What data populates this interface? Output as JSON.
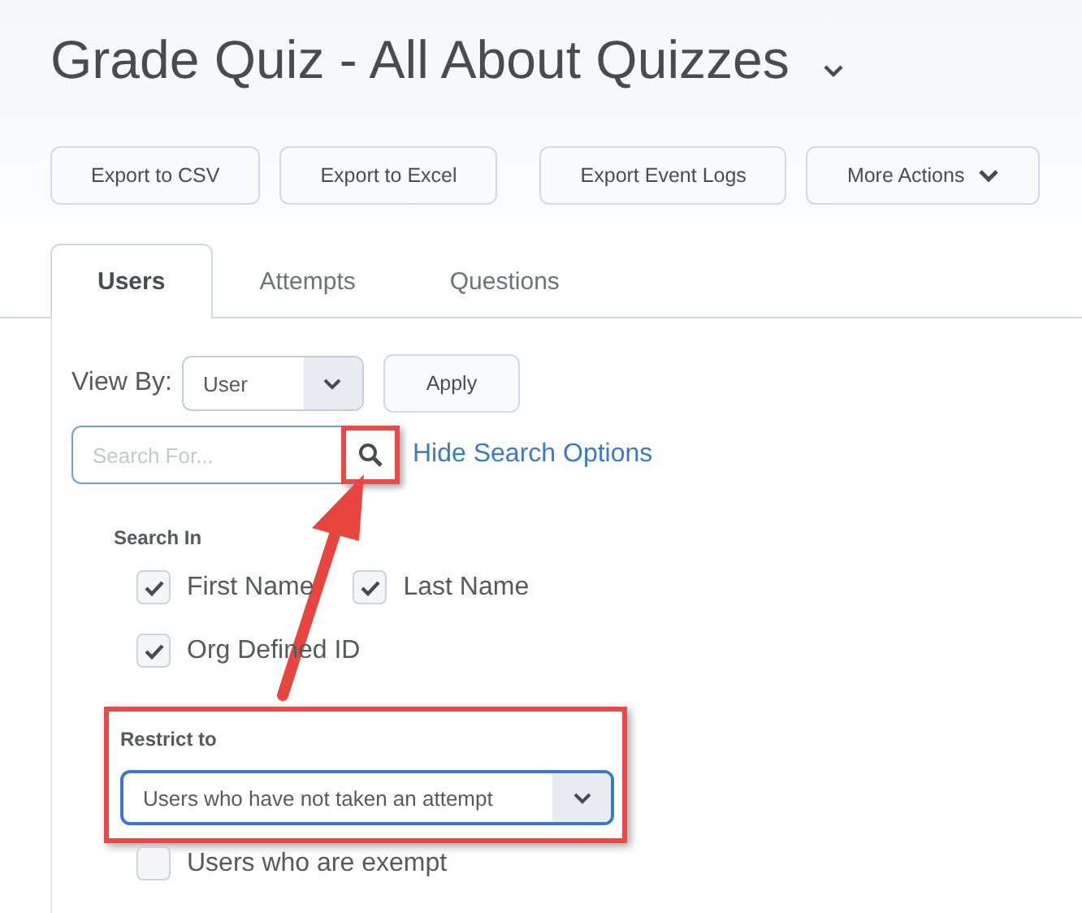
{
  "title": "Grade Quiz - All About Quizzes",
  "actions": [
    {
      "label": "Export to CSV",
      "kind": "plain"
    },
    {
      "label": "Export to Excel",
      "kind": "plain"
    },
    {
      "label": "Export Event Logs",
      "kind": "plain"
    },
    {
      "label": "More Actions",
      "kind": "menu"
    }
  ],
  "tabs": [
    {
      "label": "Users",
      "selected": true
    },
    {
      "label": "Attempts",
      "selected": false
    },
    {
      "label": "Questions",
      "selected": false
    }
  ],
  "view_by": {
    "label": "View By:",
    "value": "User",
    "button": "Apply"
  },
  "search": {
    "placeholder": "Search For...",
    "highlighted": true,
    "link": "Hide Search Options"
  },
  "search_in": {
    "label": "Search In",
    "options": [
      {
        "label": "First Name",
        "checked": true
      },
      {
        "label": "Last Name",
        "checked": true
      },
      {
        "label": "Org Defined ID",
        "checked": true
      }
    ]
  },
  "restrict": {
    "label": "Restrict to",
    "value": "Users who have not taken an attempt",
    "highlighted": true
  },
  "exempt": {
    "label": "Users who are exempt",
    "checked": false
  },
  "annotation": {
    "kind": "arrow"
  }
}
